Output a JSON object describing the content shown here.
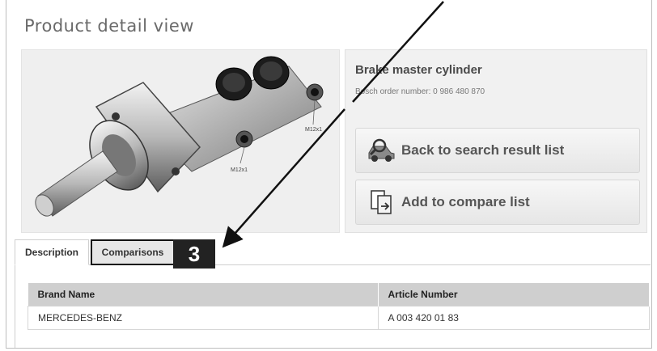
{
  "page": {
    "title": "Product detail view"
  },
  "product": {
    "name": "Brake master cylinder",
    "order_number": "Bosch order number: 0 986 480 870",
    "image_labels": [
      "M12x1",
      "M12x1"
    ]
  },
  "actions": {
    "back_label": "Back to search result list",
    "compare_label": "Add to compare list"
  },
  "tabs": [
    {
      "label": "Description",
      "active": false
    },
    {
      "label": "Comparisons",
      "active": true
    }
  ],
  "callout": {
    "number": "3"
  },
  "table": {
    "headers": [
      "Brand Name",
      "Article Number"
    ],
    "rows": [
      [
        "MERCEDES-BENZ",
        "A 003 420 01 83"
      ]
    ]
  },
  "colors": {
    "header_bg": "#cfcfcf",
    "callout_bg": "#222222",
    "title_text": "#6a6a6a"
  },
  "icons": [
    "car-search-icon",
    "document-compare-icon",
    "annotation-arrow-icon"
  ]
}
